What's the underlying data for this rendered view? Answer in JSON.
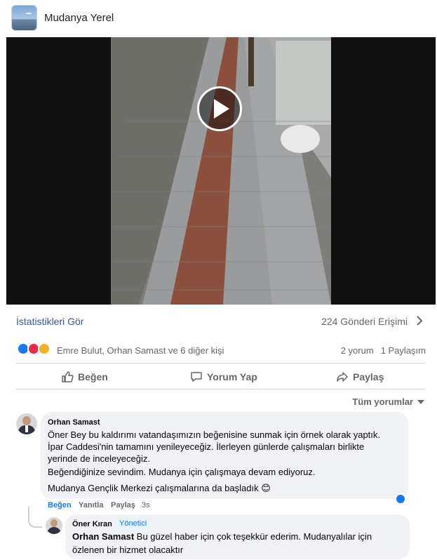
{
  "page": {
    "name": "Mudanya Yerel"
  },
  "video": {
    "play_icon": "play-icon"
  },
  "stats": {
    "link_label": "İstatistikleri Gör",
    "reach_label": "224 Gönderi Erişimi"
  },
  "reactions": {
    "icons": [
      "like-icon",
      "love-icon",
      "care-icon"
    ],
    "names": "Emre Bulut, Orhan Samast ve 6 diğer kişi",
    "comments_count": "2 yorum",
    "shares_count": "1 Paylaşım"
  },
  "actions": {
    "like": "Beğen",
    "comment": "Yorum Yap",
    "share": "Paylaş"
  },
  "comments_filter": "Tüm yorumlar",
  "comments": [
    {
      "author": "Orhan Samast",
      "lines": [
        "Öner Bey bu kaldırımı vatandaşımızın beğenisine sunmak için örnek olarak yaptık.",
        "İpar Caddesi'nin tamamını yenileyeceğiz. İlerleyen günlerde çalışmaları birlikte",
        "yerinde de inceleyeceğiz.",
        "Beğendiğinize sevindim. Mudanya için çalışmaya devam ediyoruz.",
        "Mudanya Gençlik Merkezi çalışmalarına da başladık 😊"
      ],
      "actions": {
        "like": "Beğen",
        "reply": "Yanıtla",
        "share": "Paylaş",
        "time": "3s"
      }
    },
    {
      "author": "Öner Kıran",
      "role": "Yönetici",
      "mention": "Orhan Samast",
      "text_line1": "Bu güzel haber için çok teşekkür ederim. Mudanyalılar için",
      "text_line2": "özlenen bir hizmet olacaktır"
    }
  ],
  "colors": {
    "accent": "#1877f2",
    "link": "#385898",
    "secondary_text": "#65676b",
    "bubble": "#f0f2f5"
  }
}
